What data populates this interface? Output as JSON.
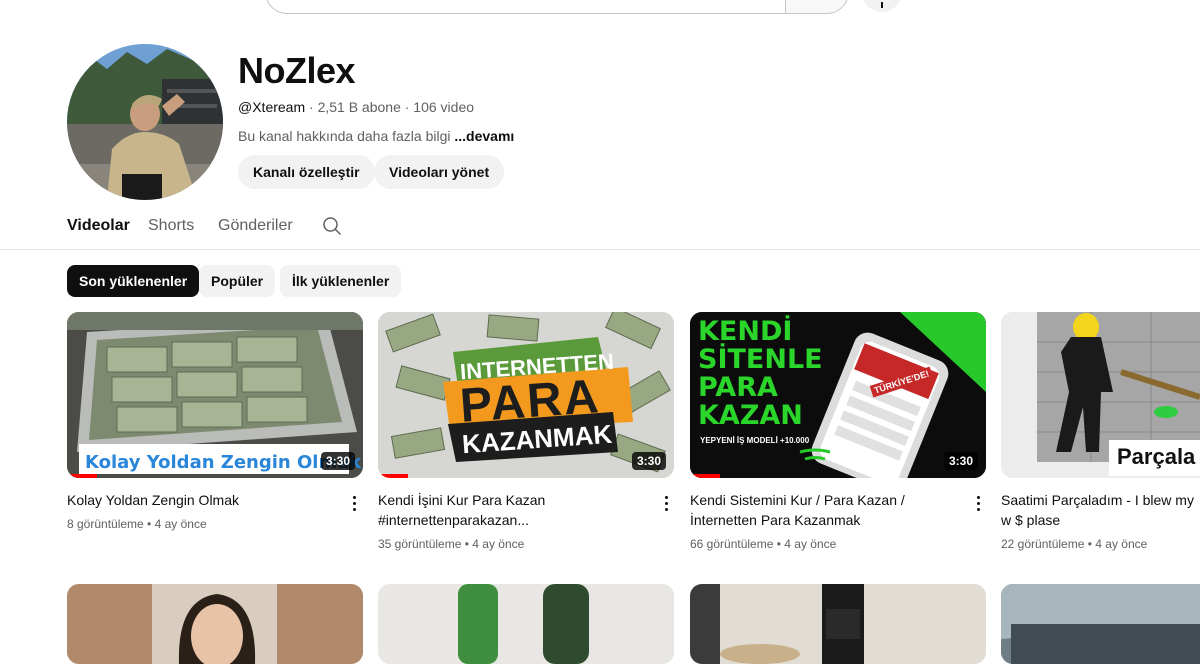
{
  "channel": {
    "name": "NoZlex",
    "handle": "@Xteream",
    "stats": " · 2,51 B abone · 106 video",
    "description": "Bu kanal hakkında daha fazla bilgi ",
    "more_label": "...devamı",
    "customize_label": "Kanalı özelleştir",
    "manage_label": "Videoları yönet"
  },
  "tabs": [
    {
      "label": "Videolar"
    },
    {
      "label": "Shorts"
    },
    {
      "label": "Gönderiler"
    }
  ],
  "chips": [
    {
      "label": "Son yüklenenler"
    },
    {
      "label": "Popüler"
    },
    {
      "label": "İlk yüklenenler"
    }
  ],
  "videos": [
    {
      "title": "Kolay Yoldan Zengin Olmak",
      "stats": "8 görüntüleme • 4 ay önce",
      "duration": "3:30",
      "overlay_text": "Kolay Yoldan Zengin Olmak",
      "progress": 0.1
    },
    {
      "title": "Kendi İşini Kur Para Kazan #internettenparakazan...",
      "stats": "35 görüntüleme • 4 ay önce",
      "duration": "3:30",
      "overlay_line1": "INTERNETTEN",
      "overlay_line2": "PARA",
      "overlay_line3": "KAZANMAK",
      "progress": 0.1
    },
    {
      "title": "Kendi Sistemini Kur / Para Kazan / İnternetten Para Kazanmak",
      "stats": "66 görüntüleme • 4 ay önce",
      "duration": "3:30",
      "overlay_line1": "KENDİ",
      "overlay_line2": "SİTENLE",
      "overlay_line3": "PARA",
      "overlay_line4": "KAZAN",
      "overlay_sub": "YEPYENİ İŞ MODELİ +10.000",
      "overlay_phone": "TÜRKİYE'DE!",
      "progress": 0.1
    },
    {
      "title": "Saatimi Parçaladım - I blew my w $ plase",
      "stats": "22 görüntüleme • 4 ay önce",
      "overlay_text": "Parçala"
    }
  ],
  "colors": {
    "accent": "#ff0000",
    "chip_active": "#0f0f0f",
    "green": "#2bd62b"
  }
}
